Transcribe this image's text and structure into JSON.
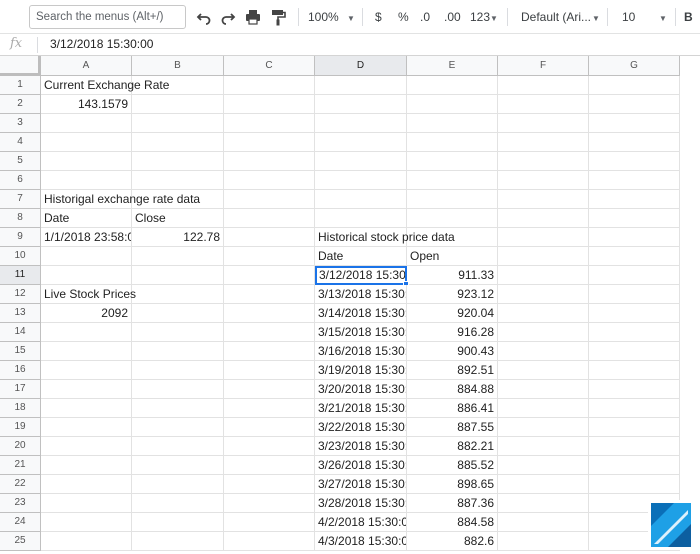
{
  "toolbar": {
    "search_placeholder": "Search the menus (Alt+/)",
    "zoom": "100%",
    "currency": "$",
    "percent": "%",
    "decrease_decimals": ".0",
    "increase_decimals": ".00",
    "more_formats": "123",
    "font": "Default (Ari...",
    "font_size": "10",
    "icons": [
      "undo-icon",
      "redo-icon",
      "print-icon",
      "paint-format-icon"
    ]
  },
  "formula_bar": {
    "fx_label": "fx",
    "value": "3/12/2018 15:30:00"
  },
  "columns": [
    "A",
    "B",
    "C",
    "D",
    "E",
    "F",
    "G"
  ],
  "rows": [
    "1",
    "2",
    "3",
    "4",
    "5",
    "6",
    "7",
    "8",
    "9",
    "10",
    "11",
    "12",
    "13",
    "14",
    "15",
    "16",
    "17",
    "18",
    "19",
    "20",
    "21",
    "22",
    "23",
    "24",
    "25"
  ],
  "selection": {
    "cell": "D11",
    "column": "D",
    "row": "11"
  },
  "sheet": {
    "exchange_title": "Current Exchange Rate",
    "exchange_rate": "143.1579",
    "hist_exchange_title": "Historigal exchange rate data",
    "hist_exchange_header": {
      "date": "Date",
      "close": "Close"
    },
    "hist_exchange_row": {
      "date": "1/1/2018 23:58:0",
      "close": "122.78"
    },
    "live_title": "Live Stock Prices",
    "live_value": "2092",
    "stock_title": "Historical stock price data",
    "stock_header": {
      "date": "Date",
      "open": "Open"
    },
    "stock_rows": [
      {
        "date": "3/12/2018 15:30:",
        "open": "911.33"
      },
      {
        "date": "3/13/2018 15:30:",
        "open": "923.12"
      },
      {
        "date": "3/14/2018 15:30:",
        "open": "920.04"
      },
      {
        "date": "3/15/2018 15:30:",
        "open": "916.28"
      },
      {
        "date": "3/16/2018 15:30:",
        "open": "900.43"
      },
      {
        "date": "3/19/2018 15:30:",
        "open": "892.51"
      },
      {
        "date": "3/20/2018 15:30:",
        "open": "884.88"
      },
      {
        "date": "3/21/2018 15:30:",
        "open": "886.41"
      },
      {
        "date": "3/22/2018 15:30:",
        "open": "887.55"
      },
      {
        "date": "3/23/2018 15:30:",
        "open": "882.21"
      },
      {
        "date": "3/26/2018 15:30:",
        "open": "885.52"
      },
      {
        "date": "3/27/2018 15:30:",
        "open": "898.65"
      },
      {
        "date": "3/28/2018 15:30:",
        "open": "887.36"
      },
      {
        "date": "4/2/2018 15:30:0",
        "open": "884.58"
      },
      {
        "date": "4/3/2018 15:30:0",
        "open": "882.6"
      }
    ]
  },
  "colors": {
    "selection": "#1a73e8",
    "header_bg": "#f8f9fa",
    "gridline": "#e2e2e2"
  }
}
